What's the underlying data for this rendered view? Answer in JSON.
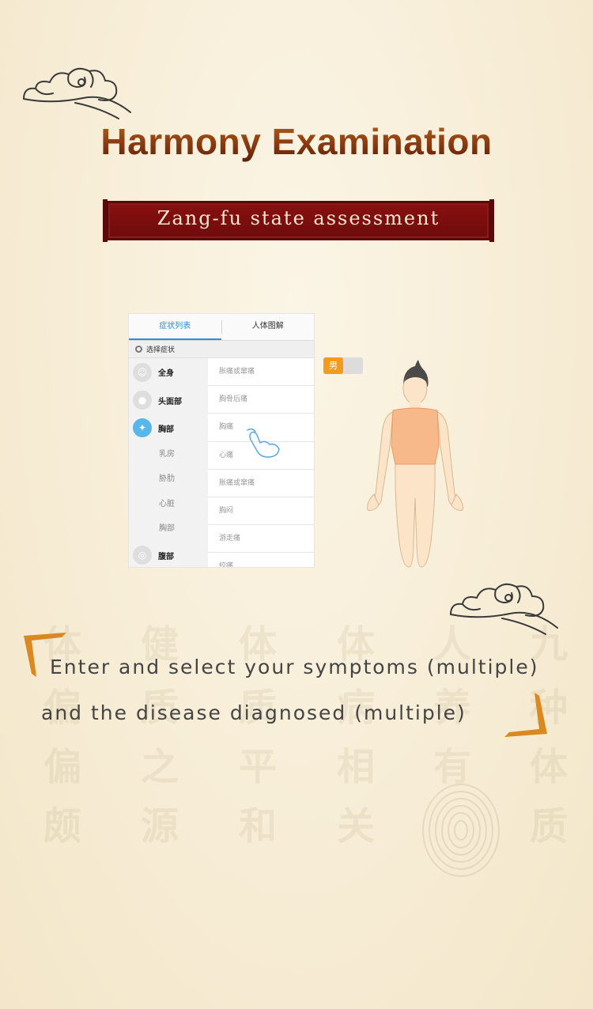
{
  "title": "Harmony Examination",
  "banner": "Zang-fu state assessment",
  "app": {
    "tabs": [
      {
        "label": "症状列表",
        "active": true
      },
      {
        "label": "人体图解",
        "active": false
      }
    ],
    "select_label": "选择症状",
    "categories": [
      {
        "label": "全身",
        "active": false
      },
      {
        "label": "头面部",
        "active": false
      },
      {
        "label": "胸部",
        "active": true
      }
    ],
    "subcategories": [
      "乳房",
      "胁肋",
      "心脏",
      "胸部"
    ],
    "last_category": {
      "label": "腹部"
    },
    "symptoms": [
      "胀痛或窜痛",
      "胸骨后痛",
      "胸痛",
      "心痛",
      "胀痛或窜痛",
      "胸闷",
      "游走痛",
      "绞痛"
    ],
    "gender_toggle": "男",
    "accent_color": "#2a8fd6",
    "toggle_color": "#f29b1e"
  },
  "description": {
    "line1": "Enter and select your symptoms (multiple)",
    "line2": "and the disease diagnosed (multiple)"
  },
  "watermark": [
    "体",
    "健",
    "体",
    "体",
    "人",
    "九",
    "偏",
    "质",
    "质",
    "病",
    "养",
    "种",
    "偏",
    "之",
    "平",
    "相",
    "有",
    "体",
    "颇",
    "源",
    "和",
    "关",
    "质"
  ],
  "colors": {
    "banner": "#6d0c0c",
    "title": "#8a3a10",
    "bracket": "#d9891f"
  }
}
